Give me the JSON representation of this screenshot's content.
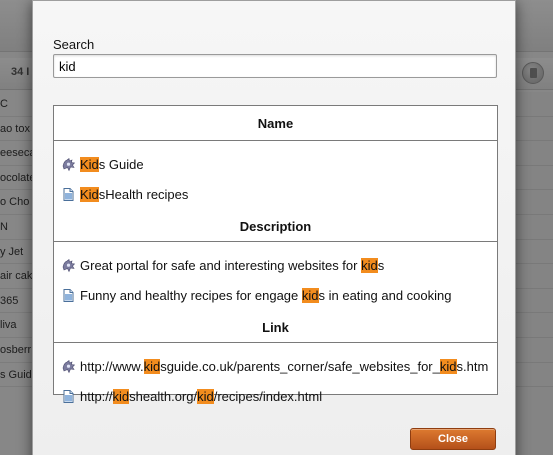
{
  "background": {
    "count_label": "34 I",
    "list_items": [
      "C",
      "ao tox",
      "eeseca",
      "ocolate",
      "o Cho",
      "N",
      "y Jet",
      "air cak",
      "365",
      "liva",
      "osberr",
      "s Guid"
    ]
  },
  "dialog": {
    "search_label": "Search",
    "search_value": "kid",
    "sections": [
      {
        "title": "Name",
        "rows": [
          {
            "icon": "web-tool-icon",
            "parts": [
              {
                "t": "Kid",
                "h": true
              },
              {
                "t": "s Guide",
                "h": false
              }
            ]
          },
          {
            "icon": "document-icon",
            "parts": [
              {
                "t": "Kid",
                "h": true
              },
              {
                "t": "sHealth recipes",
                "h": false
              }
            ]
          }
        ]
      },
      {
        "title": "Description",
        "rows": [
          {
            "icon": "web-tool-icon",
            "parts": [
              {
                "t": "Great portal for safe and interesting websites for ",
                "h": false
              },
              {
                "t": "kid",
                "h": true
              },
              {
                "t": "s",
                "h": false
              }
            ]
          },
          {
            "icon": "document-icon",
            "parts": [
              {
                "t": "Funny and healthy recipes for engage ",
                "h": false
              },
              {
                "t": "kid",
                "h": true
              },
              {
                "t": "s in eating and cooking",
                "h": false
              }
            ]
          }
        ]
      },
      {
        "title": "Link",
        "rows": [
          {
            "icon": "web-tool-icon",
            "parts": [
              {
                "t": "http://www.",
                "h": false
              },
              {
                "t": "kid",
                "h": true
              },
              {
                "t": "sguide.co.uk/parents_corner/safe_websites_for_",
                "h": false
              },
              {
                "t": "kid",
                "h": true
              },
              {
                "t": "s.htm",
                "h": false
              }
            ]
          },
          {
            "icon": "document-icon",
            "parts": [
              {
                "t": "http://",
                "h": false
              },
              {
                "t": "kid",
                "h": true
              },
              {
                "t": "shealth.org/",
                "h": false
              },
              {
                "t": "kid",
                "h": true
              },
              {
                "t": "/recipes/index.html",
                "h": false
              }
            ]
          }
        ]
      }
    ],
    "close_label": "Close"
  },
  "colors": {
    "highlight": "#f28c1e",
    "close_button": "#c8621f"
  }
}
